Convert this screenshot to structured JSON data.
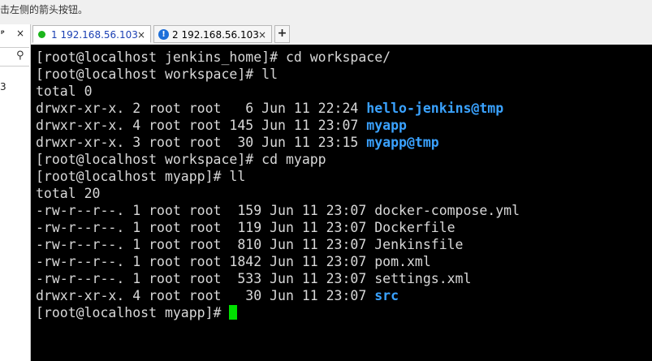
{
  "hint": "击左侧的箭头按钮。",
  "left_panel": {
    "pin": "ᵖ",
    "close": "×",
    "number": "3"
  },
  "tabs": [
    {
      "label": "1 192.168.56.103",
      "close": "×",
      "status": "connected"
    },
    {
      "label": "2 192.168.56.103",
      "close": "×",
      "status": "info"
    }
  ],
  "add_tab": "+",
  "colors": {
    "terminal_bg": "#000000",
    "text": "#d8d8d8",
    "directory": "#3aa2ff",
    "cursor": "#00e000",
    "connected": "#1bb51b"
  },
  "terminal": {
    "lines": [
      {
        "text": "[root@localhost jenkins_home]# cd workspace/"
      },
      {
        "text": "[root@localhost workspace]# ll"
      },
      {
        "text": "total 0"
      },
      {
        "text": "drwxr-xr-x. 2 root root   6 Jun 11 22:24 ",
        "name": "hello-jenkins@tmp"
      },
      {
        "text": "drwxr-xr-x. 4 root root 145 Jun 11 23:07 ",
        "name": "myapp"
      },
      {
        "text": "drwxr-xr-x. 3 root root  30 Jun 11 23:15 ",
        "name": "myapp@tmp"
      },
      {
        "text": "[root@localhost workspace]# cd myapp"
      },
      {
        "text": "[root@localhost myapp]# ll"
      },
      {
        "text": "total 20"
      },
      {
        "text": "-rw-r--r--. 1 root root  159 Jun 11 23:07 docker-compose.yml"
      },
      {
        "text": "-rw-r--r--. 1 root root  119 Jun 11 23:07 Dockerfile"
      },
      {
        "text": "-rw-r--r--. 1 root root  810 Jun 11 23:07 Jenkinsfile"
      },
      {
        "text": "-rw-r--r--. 1 root root 1842 Jun 11 23:07 pom.xml"
      },
      {
        "text": "-rw-r--r--. 1 root root  533 Jun 11 23:07 settings.xml"
      },
      {
        "text": "drwxr-xr-x. 4 root root   30 Jun 11 23:07 ",
        "name": "src"
      },
      {
        "text": "[root@localhost myapp]# "
      }
    ]
  }
}
